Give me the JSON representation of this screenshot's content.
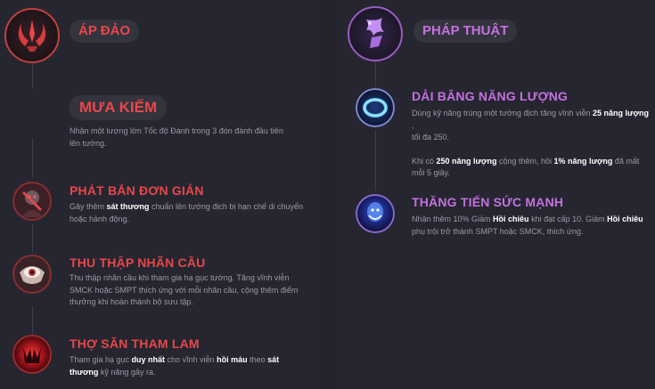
{
  "left_tree": {
    "name": "ÁP ĐẢO",
    "icon": "domination-tree-icon",
    "accent": "#e8474a",
    "keystone": {
      "name": "MƯA KIẾM",
      "desc_lines": [
        "Nhận một lượng lớn Tốc độ Đánh trong 3 đòn đánh đầu tiên",
        "lên tướng."
      ]
    },
    "runes": [
      {
        "name": "PHÁT BẮN ĐƠN GIẢN",
        "icon": "cheap-shot-icon",
        "line1": {
          "a": "Gây thêm ",
          "b": "sát thương",
          "c": " chuẩn lên tướng địch bị hạn chế di chuyển"
        },
        "line2": "hoặc hành động."
      },
      {
        "name": "THU THẬP NHÃN CẦU",
        "icon": "eyeball-collection-icon",
        "lines": [
          "Thu thập nhãn cầu khi tham gia hạ gục tướng. Tăng vĩnh viễn",
          "SMCK hoặc SMPT thích ứng với mỗi nhãn cầu, cộng thêm điểm",
          "thưởng khi hoàn thành bộ sưu tập."
        ]
      },
      {
        "name": "THỢ SĂN THAM LAM",
        "icon": "ravenous-hunter-icon",
        "line1": {
          "a": "Tham gia hạ gục ",
          "b": "duy nhất",
          "c": " cho vĩnh viễn ",
          "d": "hồi máu",
          "e": " theo ",
          "f": "sát"
        },
        "line2": {
          "a": "thương",
          "b": " kỹ năng gây ra."
        }
      }
    ]
  },
  "right_tree": {
    "name": "PHÁP THUẬT",
    "icon": "sorcery-tree-icon",
    "accent": "#c471e0",
    "runes": [
      {
        "name": "DẢI BĂNG  NĂNG LƯỢNG",
        "icon": "manaflow-band-icon",
        "l1": {
          "a": "Dùng kỹ năng trúng một tướng địch tăng vĩnh viễn ",
          "b": "25 năng lượng",
          "c": " ,"
        },
        "l2": "tối đa 250.",
        "l3": {
          "a": "Khi có ",
          "b": "250 năng lượng",
          "c": " cộng thêm, hồi ",
          "d": "1% năng lượng",
          "e": " đã mất"
        },
        "l4": "mỗi 5 giây."
      },
      {
        "name": "THĂNG TIẾN SỨC MẠNH",
        "icon": "transcendence-icon",
        "l1": {
          "a": "Nhận thêm 10% Giảm ",
          "b": "Hồi chiêu",
          "c": " khi đạt cấp 10. Giảm ",
          "d": "Hồi chiêu"
        },
        "l2": "phụ trội trở thành SMPT hoặc SMCK, thích ứng."
      }
    ]
  }
}
